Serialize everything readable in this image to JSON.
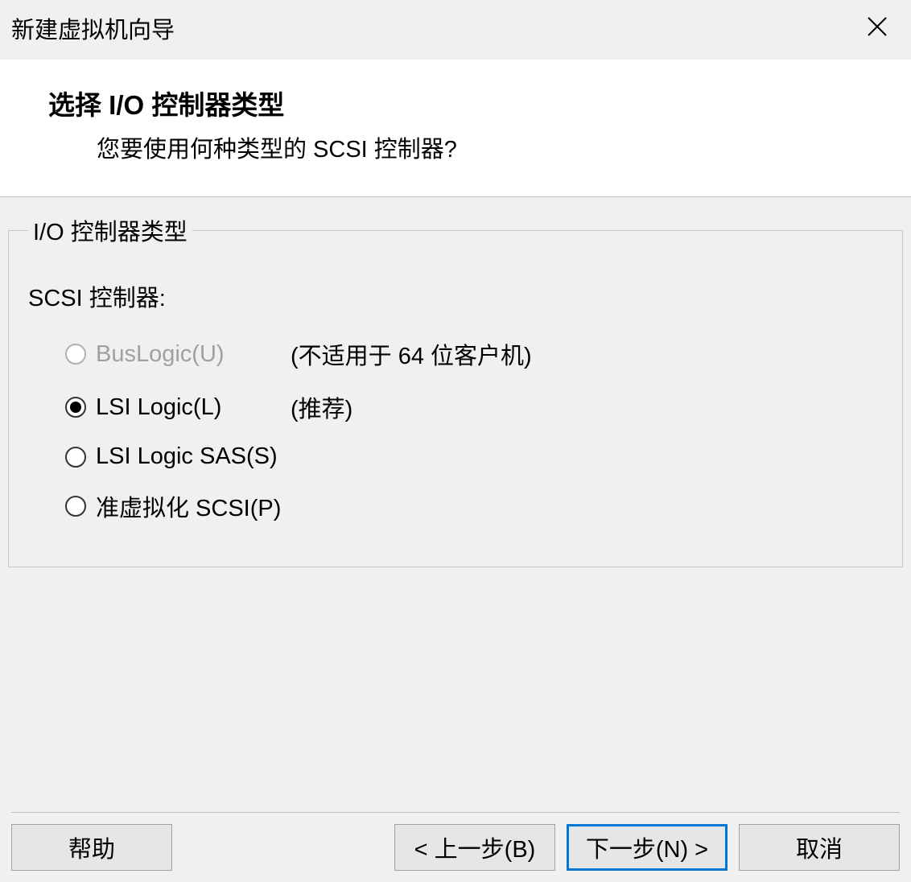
{
  "titlebar": {
    "title": "新建虚拟机向导"
  },
  "header": {
    "title": "选择 I/O 控制器类型",
    "subtitle": "您要使用何种类型的 SCSI 控制器?"
  },
  "group": {
    "legend": "I/O 控制器类型",
    "controller_label": "SCSI 控制器:",
    "options": [
      {
        "label": "BusLogic(U)",
        "note": "(不适用于 64 位客户机)",
        "disabled": true,
        "selected": false
      },
      {
        "label": "LSI Logic(L)",
        "note": "(推荐)",
        "disabled": false,
        "selected": true
      },
      {
        "label": "LSI Logic SAS(S)",
        "note": "",
        "disabled": false,
        "selected": false
      },
      {
        "label": "准虚拟化 SCSI(P)",
        "note": "",
        "disabled": false,
        "selected": false
      }
    ]
  },
  "footer": {
    "help": "帮助",
    "back": "< 上一步(B)",
    "next": "下一步(N) >",
    "cancel": "取消"
  }
}
